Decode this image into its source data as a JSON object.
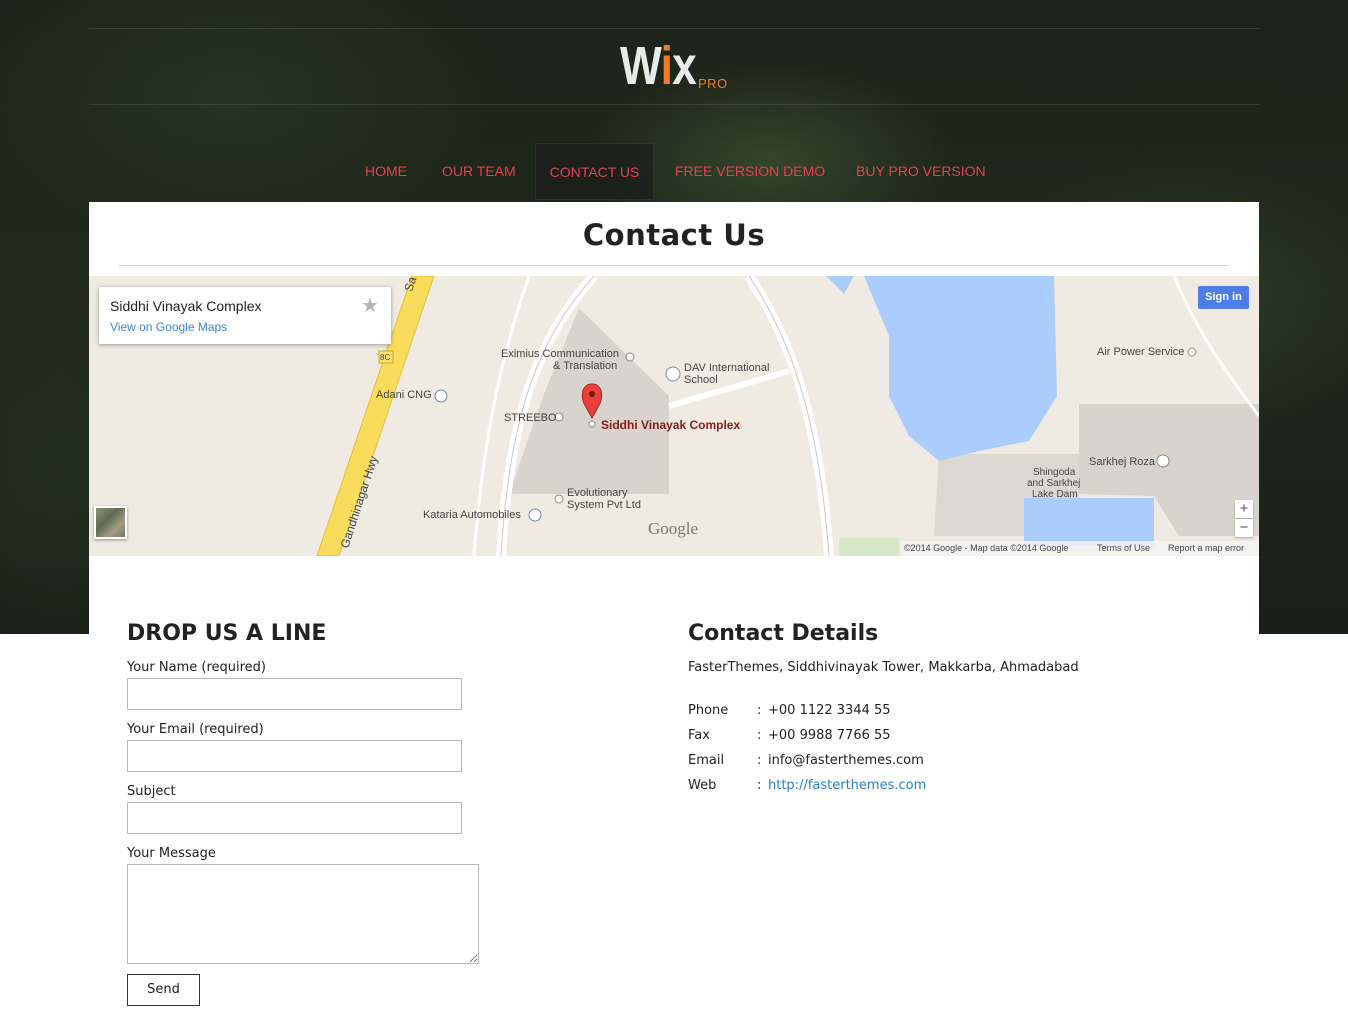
{
  "header": {
    "logo_text": "Wix",
    "logo_badge": "PRO",
    "nav": [
      {
        "label": "HOME"
      },
      {
        "label": "OUR TEAM"
      },
      {
        "label": "CONTACT US",
        "active": true
      },
      {
        "label": "FREE VERSION DEMO"
      },
      {
        "label": "BUY PRO VERSION"
      }
    ]
  },
  "page": {
    "title": "Contact Us"
  },
  "map": {
    "infobox_title": "Siddhi Vinayak Complex",
    "infobox_link": "View on Google Maps",
    "sign_in": "Sign in",
    "zoom_in": "+",
    "zoom_out": "−",
    "google_logo": "Google",
    "attribution": "©2014 Google - Map data ©2014 Google",
    "terms": "Terms of Use",
    "report": "Report a map error",
    "labels": {
      "sa": "Sa",
      "hwy": "Gandhinagar Hwy",
      "route": "8C",
      "adani": "Adani CNG",
      "eximius_1": "Eximius Communication",
      "eximius_2": "& Translation",
      "dav_1": "DAV International",
      "dav_2": "School",
      "streebo": "STREEBO",
      "marker": "Siddhi Vinayak Complex",
      "evol_1": "Evolutionary",
      "evol_2": "System Pvt Ltd",
      "kataria": "Kataria Automobiles",
      "air": "Air Power Service",
      "sarkhej": "Sarkhej Roza",
      "shingoda_1": "Shingoda",
      "shingoda_2": "and Sarkhej",
      "shingoda_3": "Lake Dam"
    },
    "colors": {
      "land": "#efebe3",
      "water": "#abcdfe",
      "highway": "#f9dc5c",
      "block": "#d8d3cc"
    }
  },
  "form": {
    "heading": "DROP US A LINE",
    "name_label": "Your Name (required)",
    "email_label": "Your Email (required)",
    "subject_label": "Subject",
    "message_label": "Your Message",
    "name_value": "",
    "email_value": "",
    "subject_value": "",
    "message_value": "",
    "send_label": "Send"
  },
  "contact": {
    "heading": "Contact Details",
    "address": "FasterThemes, Siddhivinayak Tower, Makkarba, Ahmadabad",
    "rows": [
      {
        "key": "Phone",
        "value": "+00 1122 3344 55"
      },
      {
        "key": "Fax",
        "value": "+00 9988 7766 55"
      },
      {
        "key": "Email",
        "value": "info@fasterthemes.com"
      },
      {
        "key": "Web",
        "value": "http://fasterthemes.com"
      }
    ],
    "separator": ":"
  },
  "theme": {
    "accent": "#e4424f",
    "logo_accent": "#f07e28",
    "link": "#2a7fc5"
  }
}
